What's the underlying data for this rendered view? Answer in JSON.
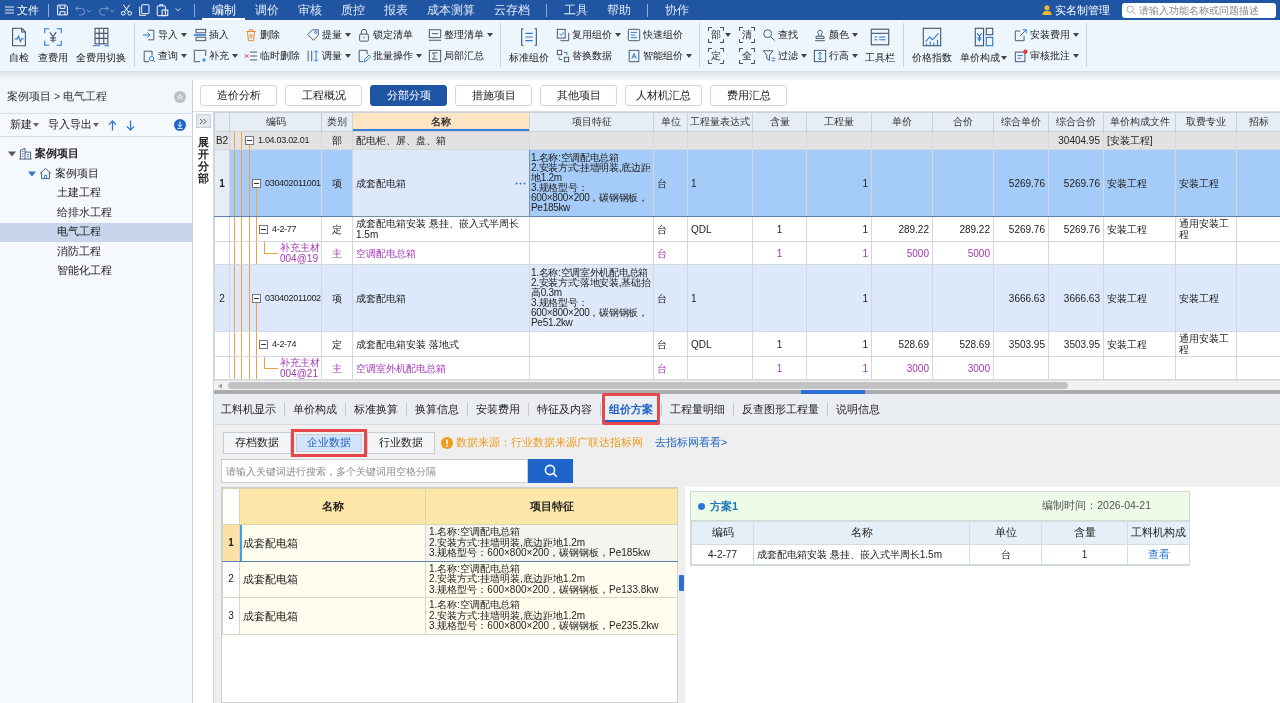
{
  "menu_bar": {
    "file_label": "文件",
    "quick_access": [
      {
        "kind": "save",
        "disabled": false
      },
      {
        "kind": "undo",
        "disabled": true
      },
      {
        "kind": "redo",
        "disabled": true
      },
      {
        "kind": "cut",
        "disabled": false
      },
      {
        "kind": "copy",
        "disabled": false
      },
      {
        "kind": "paste",
        "disabled": false
      },
      {
        "kind": "more",
        "disabled": false
      }
    ],
    "tab_groups": [
      {
        "tabs": [
          {
            "label": "编制",
            "selected": true
          },
          {
            "label": "调价",
            "selected": false
          },
          {
            "label": "审核",
            "selected": false
          },
          {
            "label": "质控",
            "selected": false
          },
          {
            "label": "报表",
            "selected": false
          },
          {
            "label": "成本测算",
            "selected": false
          },
          {
            "label": "云存档",
            "selected": false
          }
        ]
      },
      {
        "tabs": [
          {
            "label": "工具",
            "selected": false
          },
          {
            "label": "帮助",
            "selected": false
          }
        ]
      },
      {
        "tabs": [
          {
            "label": "协作",
            "selected": false
          }
        ]
      }
    ],
    "user_label": "实名制管理",
    "search": {
      "placeholder": "请输入功能名称或问题描述"
    }
  },
  "ribbon": {
    "groups": [
      {
        "items": [
          {
            "kind": "large",
            "label": "自检",
            "dropdown": false
          },
          {
            "kind": "large",
            "label": "查费用",
            "dropdown": false
          },
          {
            "kind": "large",
            "label": "全费用切换",
            "dropdown": false
          }
        ]
      },
      {
        "items": [
          {
            "kind": "stack",
            "buttons": [
              {
                "label": "导入",
                "dropdown": true
              },
              {
                "label": "查询",
                "dropdown": true
              }
            ]
          },
          {
            "kind": "stack",
            "buttons": [
              {
                "label": "插入",
                "dropdown": false
              },
              {
                "label": "补充",
                "dropdown": true
              }
            ]
          },
          {
            "kind": "stack",
            "buttons": [
              {
                "label": "删除",
                "dropdown": false
              },
              {
                "label": "临时删除",
                "dropdown": false
              }
            ]
          },
          {
            "kind": "stack",
            "buttons": [
              {
                "label": "提量",
                "dropdown": true
              },
              {
                "label": "调量",
                "dropdown": true
              }
            ]
          },
          {
            "kind": "stack",
            "buttons": [
              {
                "label": "锁定清单",
                "dropdown": false
              },
              {
                "label": "批量操作",
                "dropdown": true
              }
            ]
          },
          {
            "kind": "stack",
            "buttons": [
              {
                "label": "整理清单",
                "dropdown": true
              },
              {
                "label": "局部汇总",
                "dropdown": false
              }
            ]
          }
        ]
      },
      {
        "items": [
          {
            "kind": "large",
            "label": "标准组价",
            "dropdown": false
          },
          {
            "kind": "stack",
            "buttons": [
              {
                "label": "复用组价",
                "dropdown": true
              },
              {
                "label": "替换数据",
                "dropdown": false
              }
            ]
          },
          {
            "kind": "stack",
            "buttons": [
              {
                "label": "快速组价",
                "dropdown": false
              },
              {
                "label": "智能组价",
                "dropdown": true
              }
            ]
          }
        ]
      },
      {
        "items": [
          {
            "kind": "glyphs",
            "buttons": [
              {
                "glyph": "部",
                "dropdown": true
              },
              {
                "glyph": "定",
                "dropdown": false
              }
            ]
          },
          {
            "kind": "glyphs",
            "buttons": [
              {
                "glyph": "清",
                "dropdown": false
              },
              {
                "glyph": "全",
                "dropdown": false
              }
            ]
          },
          {
            "kind": "stack",
            "buttons": [
              {
                "label": "查找",
                "dropdown": false
              },
              {
                "label": "过滤",
                "dropdown": true
              }
            ]
          },
          {
            "kind": "stack",
            "buttons": [
              {
                "label": "颜色",
                "dropdown": true
              },
              {
                "label": "行高",
                "dropdown": true
              }
            ]
          },
          {
            "kind": "large",
            "label": "工具栏",
            "dropdown": false
          }
        ]
      },
      {
        "items": [
          {
            "kind": "large",
            "label": "价格指数",
            "dropdown": false
          },
          {
            "kind": "large",
            "label": "单价构成",
            "dropdown": true
          },
          {
            "kind": "stack",
            "buttons": [
              {
                "label": "安装费用",
                "dropdown": true
              },
              {
                "label": "审核批注",
                "dropdown": true
              }
            ]
          }
        ]
      }
    ]
  },
  "sidebar": {
    "breadcrumb": "案例项目 > 电气工程",
    "toolbar": [
      {
        "label": "新建",
        "dropdown": true
      },
      {
        "label": "导入导出",
        "dropdown": true
      }
    ],
    "tree": [
      {
        "label": "案例项目",
        "expanded": true,
        "selected": false,
        "children": [
          {
            "label": "案例项目",
            "expanded": true,
            "selected": false,
            "children": [
              {
                "label": "土建工程",
                "selected": false
              },
              {
                "label": "给排水工程",
                "selected": false
              },
              {
                "label": "电气工程",
                "selected": true
              },
              {
                "label": "消防工程",
                "selected": false
              },
              {
                "label": "智能化工程",
                "selected": false
              }
            ]
          }
        ]
      }
    ]
  },
  "view_tabs": [
    {
      "label": "造价分析",
      "selected": false
    },
    {
      "label": "工程概况",
      "selected": false
    },
    {
      "label": "分部分项",
      "selected": true
    },
    {
      "label": "措施项目",
      "selected": false
    },
    {
      "label": "其他项目",
      "selected": false
    },
    {
      "label": "人材机汇总",
      "selected": false
    },
    {
      "label": "费用汇总",
      "selected": false
    }
  ],
  "side_strip": {
    "label": "展开分部"
  },
  "grid": {
    "columns": [
      {
        "label": "编码",
        "selected": false
      },
      {
        "label": "类别",
        "selected": false
      },
      {
        "label": "名称",
        "selected": true
      },
      {
        "label": "项目特征",
        "selected": false
      },
      {
        "label": "单位",
        "selected": false
      },
      {
        "label": "工程量表达式",
        "selected": false
      },
      {
        "label": "含量",
        "selected": false
      },
      {
        "label": "工程量",
        "selected": false
      },
      {
        "label": "单价",
        "selected": false
      },
      {
        "label": "合价",
        "selected": false
      },
      {
        "label": "综合单价",
        "selected": false
      },
      {
        "label": "综合合价",
        "selected": false
      },
      {
        "label": "单价构成文件",
        "selected": false
      },
      {
        "label": "取费专业",
        "selected": false
      },
      {
        "label": "招标",
        "selected": false
      }
    ],
    "rows": [
      {
        "kind": "section",
        "number": "B2",
        "code": "1.04.03.02.01",
        "expanded": true,
        "type": "部",
        "name": "配电柜、屏、盘、箱",
        "comp_total": "30404.95",
        "price_file": "[安装工程]",
        "selected": false
      },
      {
        "kind": "item",
        "number": "1",
        "code": "030402011001",
        "expanded": true,
        "type": "项",
        "name": "成套配电箱",
        "features": [
          "1.名称:空调配电总箱",
          "2.安装方式:挂墙明装,底边距地1.2m",
          "3.规格型号：600×800×200，碳钢钢板，Pe185kw"
        ],
        "unit": "台",
        "expression": "1",
        "quantity": "1",
        "comp_unit_price": "5269.76",
        "comp_total": "5269.76",
        "price_file": "安装工程",
        "fee_category": "安装工程",
        "selected": true
      },
      {
        "kind": "quota",
        "code": "4-2-77",
        "expanded": true,
        "type": "定",
        "name": "成套配电箱安装 悬挂、嵌入式半周长1.5m",
        "unit": "台",
        "expression": "QDL",
        "content": "1",
        "quantity": "1",
        "unit_price": "289.22",
        "total": "289.22",
        "comp_unit_price": "5269.76",
        "comp_total": "5269.76",
        "price_file": "安装工程",
        "fee_category": "通用安装工程",
        "selected": false
      },
      {
        "kind": "material",
        "code": "补充主材 004@19",
        "type": "主",
        "name": "空调配电总箱",
        "unit": "台",
        "content": "1",
        "quantity": "1",
        "unit_price": "5000",
        "total": "5000",
        "selected": false
      },
      {
        "kind": "item",
        "number": "2",
        "code": "030402011002",
        "expanded": true,
        "type": "项",
        "name": "成套配电箱",
        "features": [
          "1.名称:空调室外机配电总箱",
          "2.安装方式:落地安装,基础抬高0.3m",
          "3.规格型号：600×800×200，碳钢钢板，Pe51.2kw"
        ],
        "unit": "台",
        "expression": "1",
        "quantity": "1",
        "comp_unit_price": "3666.63",
        "comp_total": "3666.63",
        "price_file": "安装工程",
        "fee_category": "安装工程",
        "selected": false
      },
      {
        "kind": "quota",
        "code": "4-2-74",
        "expanded": true,
        "type": "定",
        "name": "成套配电箱安装 落地式",
        "unit": "台",
        "expression": "QDL",
        "content": "1",
        "quantity": "1",
        "unit_price": "528.69",
        "total": "528.69",
        "comp_unit_price": "3503.95",
        "comp_total": "3503.95",
        "price_file": "安装工程",
        "fee_category": "通用安装工程",
        "selected": false
      },
      {
        "kind": "material",
        "code": "补充主材 004@21",
        "type": "主",
        "name": "空调室外机配电总箱",
        "unit": "台",
        "content": "1",
        "quantity": "1",
        "unit_price": "3000",
        "total": "3000",
        "selected": false
      }
    ]
  },
  "detail_panel": {
    "tabs": [
      {
        "label": "工料机显示",
        "selected": false,
        "highlighted": false
      },
      {
        "label": "单价构成",
        "selected": false,
        "highlighted": false
      },
      {
        "label": "标准换算",
        "selected": false,
        "highlighted": false
      },
      {
        "label": "换算信息",
        "selected": false,
        "highlighted": false
      },
      {
        "label": "安装费用",
        "selected": false,
        "highlighted": false
      },
      {
        "label": "特征及内容",
        "selected": false,
        "highlighted": false
      },
      {
        "label": "组价方案",
        "selected": true,
        "highlighted": true
      },
      {
        "label": "工程量明细",
        "selected": false,
        "highlighted": false
      },
      {
        "label": "反查图形工程量",
        "selected": false,
        "highlighted": false
      },
      {
        "label": "说明信息",
        "selected": false,
        "highlighted": false
      }
    ],
    "data_tabs": [
      {
        "label": "存档数据",
        "selected": false,
        "highlighted": false
      },
      {
        "label": "企业数据",
        "selected": true,
        "highlighted": true
      },
      {
        "label": "行业数据",
        "selected": false,
        "highlighted": false
      }
    ],
    "notice": "数据来源：行业数据来源广联达指标网",
    "notice_link": "去指标网看看>",
    "search": {
      "placeholder": "请输入关键词进行搜索，多个关键词用空格分隔"
    },
    "results": {
      "columns": [
        "名称",
        "项目特征"
      ],
      "rows": [
        {
          "number": "1",
          "name": "成套配电箱",
          "features": [
            "1.名称:空调配电总箱",
            "2.安装方式:挂墙明装,底边距地1.2m",
            "3.规格型号：600×800×200，碳钢钢板，Pe185kw"
          ],
          "selected": true
        },
        {
          "number": "2",
          "name": "成套配电箱",
          "features": [
            "1.名称:空调配电总箱",
            "2.安装方式:挂墙明装,底边距地1.2m",
            "3.规格型号：600×800×200，碳钢钢板，Pe133.8kw"
          ],
          "selected": false
        },
        {
          "number": "3",
          "name": "成套配电箱",
          "features": [
            "1.名称:空调配电总箱",
            "2.安装方式:挂墙明装,底边距地1.2m",
            "3.规格型号：600×800×200，碳钢钢板，Pe235.2kw"
          ],
          "selected": false
        }
      ]
    },
    "plan": {
      "title": "方案1",
      "date": "编制时间：2026-04-21",
      "columns": [
        "编码",
        "名称",
        "单位",
        "含量",
        "工料机构成"
      ],
      "rows": [
        {
          "code": "4-2-77",
          "name": "成套配电箱安装 悬挂、嵌入式半周长1.5m",
          "unit": "台",
          "content": "1",
          "link": "查看"
        }
      ]
    }
  }
}
